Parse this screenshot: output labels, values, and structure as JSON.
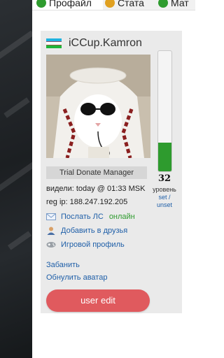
{
  "tabs": [
    {
      "label": "Профайл",
      "icon": "smile-icon",
      "color": "#2e9b2e"
    },
    {
      "label": "Стата",
      "icon": "stats-icon",
      "color": "#e0a020"
    },
    {
      "label": "Мат",
      "icon": "match-icon",
      "color": "#2e9b2e"
    }
  ],
  "profile": {
    "country_flag": "uzbekistan-flag",
    "nickname": "iCCup.Kamron",
    "avatar": "cat-avatar",
    "role": "Trial Donate Manager",
    "last_seen": "видели: today @ 01:33 MSK",
    "reg_ip": "reg ip: 188.247.192.205"
  },
  "level": {
    "value": "32",
    "label": "уровень",
    "set_label": "set /",
    "unset_label": "unset",
    "fill_fraction": 0.24,
    "color": "#2e9b2e"
  },
  "actions": {
    "send_pm": "Послать ЛС",
    "online_status": "онлайн",
    "add_friend": "Добавить в друзья",
    "game_profile": "Игровой профиль"
  },
  "admin": {
    "ban": "Забанить",
    "reset_avatar": "Обнулить аватар"
  },
  "edit_button": "user edit",
  "colors": {
    "link": "#1f5fa8",
    "online": "#2e9b2e",
    "button": "#e05a5e",
    "card": "#eaeaea"
  }
}
